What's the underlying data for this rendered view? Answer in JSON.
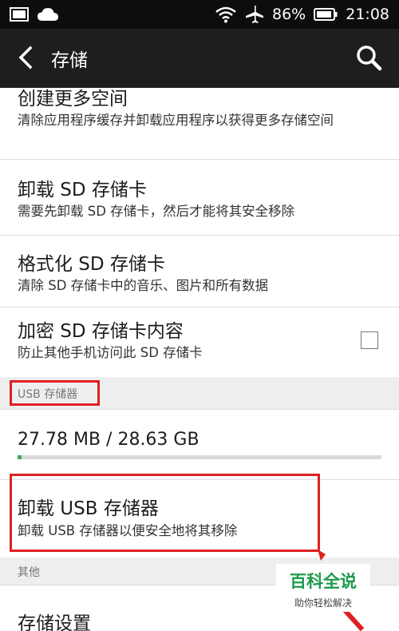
{
  "status_bar": {
    "battery": "86%",
    "time": "21:08"
  },
  "app_bar": {
    "title": "存储"
  },
  "items": [
    {
      "title": "创建更多空间",
      "subtitle": "清除应用程序缓存并卸载应用程序以获得更多存储空间"
    },
    {
      "title": "卸载 SD 存储卡",
      "subtitle": "需要先卸载 SD 存储卡，然后才能将其安全移除"
    },
    {
      "title": "格式化 SD 存储卡",
      "subtitle": "清除 SD 存储卡中的音乐、图片和所有数据"
    },
    {
      "title": "加密 SD 存储卡内容",
      "subtitle": "防止其他手机访问此 SD 存储卡",
      "checked": false
    }
  ],
  "usb_section": {
    "header": "USB 存储器",
    "usage": "27.78 MB / 28.63 GB",
    "usage_fraction": 0.001,
    "unmount_title": "卸载 USB 存储器",
    "unmount_subtitle": "卸载 USB 存储器以便安全地将其移除"
  },
  "other_section": {
    "header": "其他",
    "settings_title": "存储设置"
  },
  "watermark": {
    "title": "百科全说",
    "subtitle": "助你轻松解决"
  },
  "colors": {
    "annotation_red": "#e02020",
    "progress_green": "#3dae4a"
  }
}
